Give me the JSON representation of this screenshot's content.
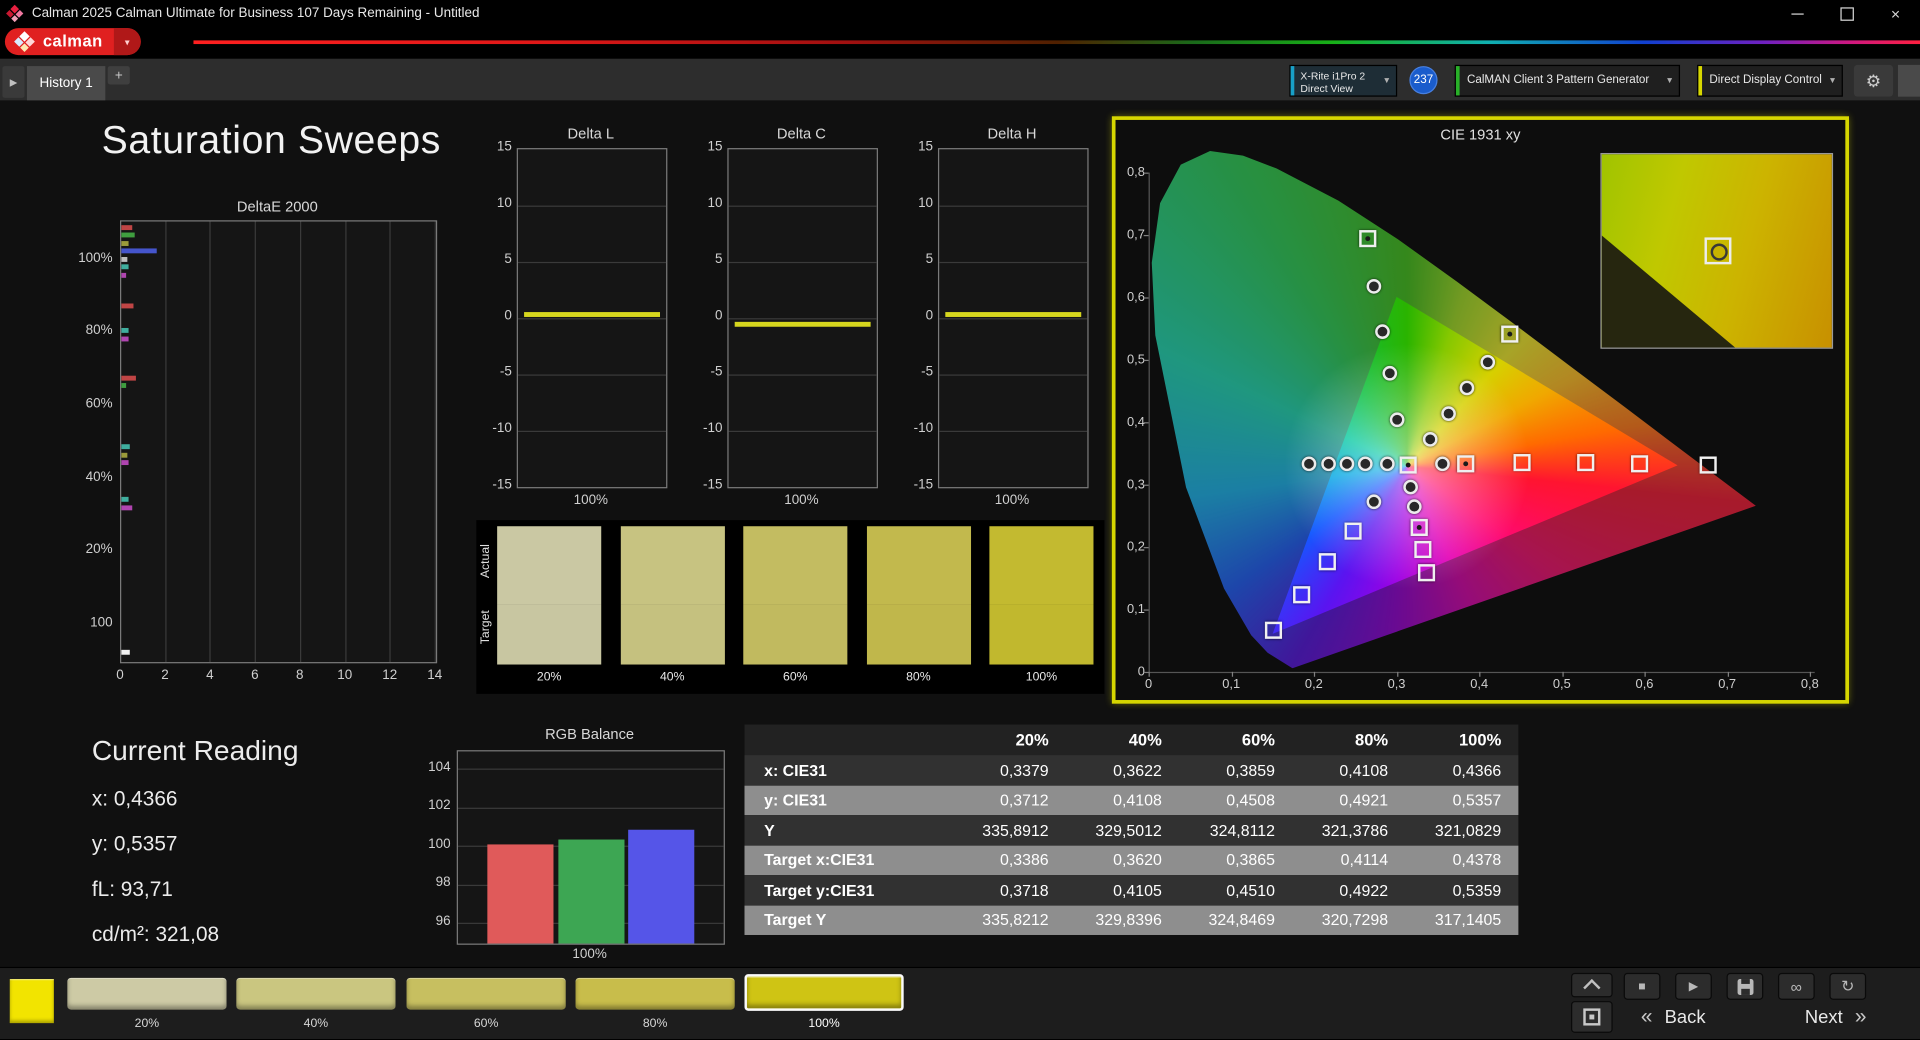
{
  "window": {
    "title": "Calman 2025 Calman Ultimate for Business 107 Days Remaining  - Untitled"
  },
  "brand": {
    "logo_text": "calman"
  },
  "icons": {
    "caret_down": "▼",
    "caret_down_small": "▾",
    "gear": "⚙",
    "play": "▶",
    "stop": "■",
    "infinity": "∞",
    "refresh": "↻",
    "back_arrows": "«",
    "next_arrows": "»",
    "add": "+",
    "tab_nav": "▶",
    "minimize": "–",
    "close": "×"
  },
  "tabs": {
    "history_label": "History 1",
    "add_label": "+"
  },
  "devices": {
    "meter_line1": "X-Rite i1Pro 2",
    "meter_line2": "Direct View",
    "meter_badge": "237",
    "meter_accent": "#18a0c8",
    "pattern_label": "CalMAN Client 3 Pattern Generator",
    "pattern_accent": "#28b028",
    "display_label": "Direct Display Control",
    "display_accent": "#d8d800"
  },
  "page": {
    "title": "Saturation Sweeps"
  },
  "current_reading": {
    "title": "Current Reading",
    "lines": [
      "x: 0,4366",
      "y: 0,5357",
      "fL: 93,71",
      "cd/m²: 321,08"
    ]
  },
  "bottom_bar": {
    "current_color_swatch": "#f2e400",
    "patches": [
      {
        "label": "20%",
        "color": "#cdcaa5",
        "selected": false
      },
      {
        "label": "40%",
        "color": "#cac680",
        "selected": false
      },
      {
        "label": "60%",
        "color": "#c7bf60",
        "selected": false
      },
      {
        "label": "80%",
        "color": "#c8bd4b",
        "selected": false
      },
      {
        "label": "100%",
        "color": "#cfc414",
        "selected": true
      }
    ],
    "back_label": "Back",
    "next_label": "Next"
  },
  "chart_data": [
    {
      "id": "deltae2000",
      "type": "bar",
      "orientation": "horizontal",
      "title": "DeltaE 2000",
      "xlim": [
        0,
        14
      ],
      "x_ticks": [
        "0",
        "2",
        "4",
        "6",
        "8",
        "10",
        "12",
        "14"
      ],
      "y_tick_labels": [
        {
          "label": "100%",
          "pos": 0.086
        },
        {
          "label": "80%",
          "pos": 0.251
        },
        {
          "label": "60%",
          "pos": 0.417
        },
        {
          "label": "40%",
          "pos": 0.583
        },
        {
          "label": "20%",
          "pos": 0.748
        },
        {
          "label": "100",
          "pos": 0.914
        }
      ],
      "bars": [
        {
          "color": "#c04545",
          "pos": 0.008,
          "value": 0.5
        },
        {
          "color": "#3f9e3f",
          "pos": 0.026,
          "value": 0.6
        },
        {
          "color": "#9a9a3a",
          "pos": 0.044,
          "value": 0.3
        },
        {
          "color": "#4555cc",
          "pos": 0.06,
          "value": 1.6
        },
        {
          "color": "#bdbdbd",
          "pos": 0.08,
          "value": 0.25
        },
        {
          "color": "#3fae9e",
          "pos": 0.098,
          "value": 0.3
        },
        {
          "color": "#b045b0",
          "pos": 0.116,
          "value": 0.2
        },
        {
          "color": "#c04545",
          "pos": 0.185,
          "value": 0.55
        },
        {
          "color": "#3fae9e",
          "pos": 0.243,
          "value": 0.35
        },
        {
          "color": "#b045b0",
          "pos": 0.261,
          "value": 0.3
        },
        {
          "color": "#c04545",
          "pos": 0.35,
          "value": 0.65
        },
        {
          "color": "#3f9e3f",
          "pos": 0.368,
          "value": 0.2
        },
        {
          "color": "#3fae9e",
          "pos": 0.506,
          "value": 0.4
        },
        {
          "color": "#9a9a3a",
          "pos": 0.524,
          "value": 0.25
        },
        {
          "color": "#b045b0",
          "pos": 0.542,
          "value": 0.3
        },
        {
          "color": "#3fae9e",
          "pos": 0.626,
          "value": 0.35
        },
        {
          "color": "#b045b0",
          "pos": 0.644,
          "value": 0.5
        },
        {
          "color": "#f0f0f0",
          "pos": 0.972,
          "value": 0.4
        }
      ]
    },
    {
      "id": "delta_l",
      "type": "line",
      "title": "Delta L",
      "ylim": [
        -15,
        15
      ],
      "y_ticks": [
        "15",
        "10",
        "5",
        "0",
        "-5",
        "-10",
        "-15"
      ],
      "x_label": "100%",
      "value": 0.3,
      "line_color": "#d6d61e"
    },
    {
      "id": "delta_c",
      "type": "line",
      "title": "Delta C",
      "ylim": [
        -15,
        15
      ],
      "y_ticks": [
        "15",
        "10",
        "5",
        "0",
        "-5",
        "-10",
        "-15"
      ],
      "x_label": "100%",
      "value": -0.5,
      "line_color": "#d6d61e"
    },
    {
      "id": "delta_h",
      "type": "line",
      "title": "Delta H",
      "ylim": [
        -15,
        15
      ],
      "y_ticks": [
        "15",
        "10",
        "5",
        "0",
        "-5",
        "-10",
        "-15"
      ],
      "x_label": "100%",
      "value": 0.3,
      "line_color": "#d6d61e"
    },
    {
      "id": "saturation_swatches",
      "type": "table",
      "row_labels": [
        "Actual",
        "Target"
      ],
      "levels": [
        "20%",
        "40%",
        "60%",
        "80%",
        "100%"
      ],
      "actual_colors": [
        "#cac8a3",
        "#c7c381",
        "#c3bc61",
        "#c2b94d",
        "#c3ba30"
      ],
      "target_colors": [
        "#c8c6a1",
        "#c5c17f",
        "#c1ba5f",
        "#c0b74b",
        "#c1b82e"
      ]
    },
    {
      "id": "cie1931",
      "type": "scatter",
      "title": "CIE 1931 xy",
      "xlim": [
        0,
        0.8
      ],
      "ylim": [
        0,
        0.8
      ],
      "x_ticks": [
        "0",
        "0,1",
        "0,2",
        "0,3",
        "0,4",
        "0,5",
        "0,6",
        "0,7",
        "0,8"
      ],
      "y_ticks": [
        "0",
        "0,1",
        "0,2",
        "0,3",
        "0,4",
        "0,5",
        "0,6",
        "0,7",
        "0,8"
      ],
      "points": [
        {
          "x": 0.194,
          "y": 0.332,
          "m": "dot"
        },
        {
          "x": 0.218,
          "y": 0.332,
          "m": "dot"
        },
        {
          "x": 0.24,
          "y": 0.332,
          "m": "dot"
        },
        {
          "x": 0.262,
          "y": 0.332,
          "m": "dot"
        },
        {
          "x": 0.289,
          "y": 0.332,
          "m": "dot"
        },
        {
          "x": 0.314,
          "y": 0.33,
          "m": "square_dot"
        },
        {
          "x": 0.355,
          "y": 0.332,
          "m": "dot"
        },
        {
          "x": 0.384,
          "y": 0.333,
          "m": "square_dot"
        },
        {
          "x": 0.452,
          "y": 0.334,
          "m": "square"
        },
        {
          "x": 0.529,
          "y": 0.335,
          "m": "square"
        },
        {
          "x": 0.594,
          "y": 0.333,
          "m": "square"
        },
        {
          "x": 0.677,
          "y": 0.331,
          "m": "square"
        },
        {
          "x": 0.265,
          "y": 0.694,
          "m": "square_dot"
        },
        {
          "x": 0.273,
          "y": 0.616,
          "m": "dot"
        },
        {
          "x": 0.283,
          "y": 0.545,
          "m": "dot"
        },
        {
          "x": 0.292,
          "y": 0.478,
          "m": "dot"
        },
        {
          "x": 0.301,
          "y": 0.404,
          "m": "dot"
        },
        {
          "x": 0.437,
          "y": 0.54,
          "m": "square_dot"
        },
        {
          "x": 0.41,
          "y": 0.496,
          "m": "dot"
        },
        {
          "x": 0.385,
          "y": 0.455,
          "m": "dot"
        },
        {
          "x": 0.363,
          "y": 0.413,
          "m": "dot"
        },
        {
          "x": 0.34,
          "y": 0.372,
          "m": "dot"
        },
        {
          "x": 0.317,
          "y": 0.296,
          "m": "dot"
        },
        {
          "x": 0.322,
          "y": 0.263,
          "m": "dot"
        },
        {
          "x": 0.327,
          "y": 0.231,
          "m": "square_dot"
        },
        {
          "x": 0.332,
          "y": 0.196,
          "m": "square"
        },
        {
          "x": 0.337,
          "y": 0.158,
          "m": "square"
        },
        {
          "x": 0.272,
          "y": 0.272,
          "m": "dot"
        },
        {
          "x": 0.247,
          "y": 0.225,
          "m": "square"
        },
        {
          "x": 0.216,
          "y": 0.176,
          "m": "square"
        },
        {
          "x": 0.185,
          "y": 0.122,
          "m": "square"
        },
        {
          "x": 0.151,
          "y": 0.065,
          "m": "square"
        }
      ]
    },
    {
      "id": "rgb_balance",
      "type": "bar",
      "title": "RGB Balance",
      "ylim": [
        96,
        104
      ],
      "y_ticks": [
        "104",
        "102",
        "100",
        "98",
        "96"
      ],
      "x_label": "100%",
      "series": [
        {
          "name": "red",
          "value": 100.1,
          "color": "#e05a5a"
        },
        {
          "name": "green",
          "value": 100.4,
          "color": "#3da653"
        },
        {
          "name": "blue",
          "value": 100.9,
          "color": "#5555e8"
        }
      ]
    },
    {
      "id": "measurement_table",
      "type": "table",
      "columns": [
        "",
        "20%",
        "40%",
        "60%",
        "80%",
        "100%"
      ],
      "rows": [
        {
          "label": "x: CIE31",
          "values": [
            "0,3379",
            "0,3622",
            "0,3859",
            "0,4108",
            "0,4366"
          ]
        },
        {
          "label": "y: CIE31",
          "values": [
            "0,3712",
            "0,4108",
            "0,4508",
            "0,4921",
            "0,5357"
          ]
        },
        {
          "label": "Y",
          "values": [
            "335,8912",
            "329,5012",
            "324,8112",
            "321,3786",
            "321,0829"
          ]
        },
        {
          "label": "Target x:CIE31",
          "values": [
            "0,3386",
            "0,3620",
            "0,3865",
            "0,4114",
            "0,4378"
          ]
        },
        {
          "label": "Target y:CIE31",
          "values": [
            "0,3718",
            "0,4105",
            "0,4510",
            "0,4922",
            "0,5359"
          ]
        },
        {
          "label": "Target Y",
          "values": [
            "335,8212",
            "329,8396",
            "324,8469",
            "320,7298",
            "317,1405"
          ]
        }
      ]
    }
  ]
}
